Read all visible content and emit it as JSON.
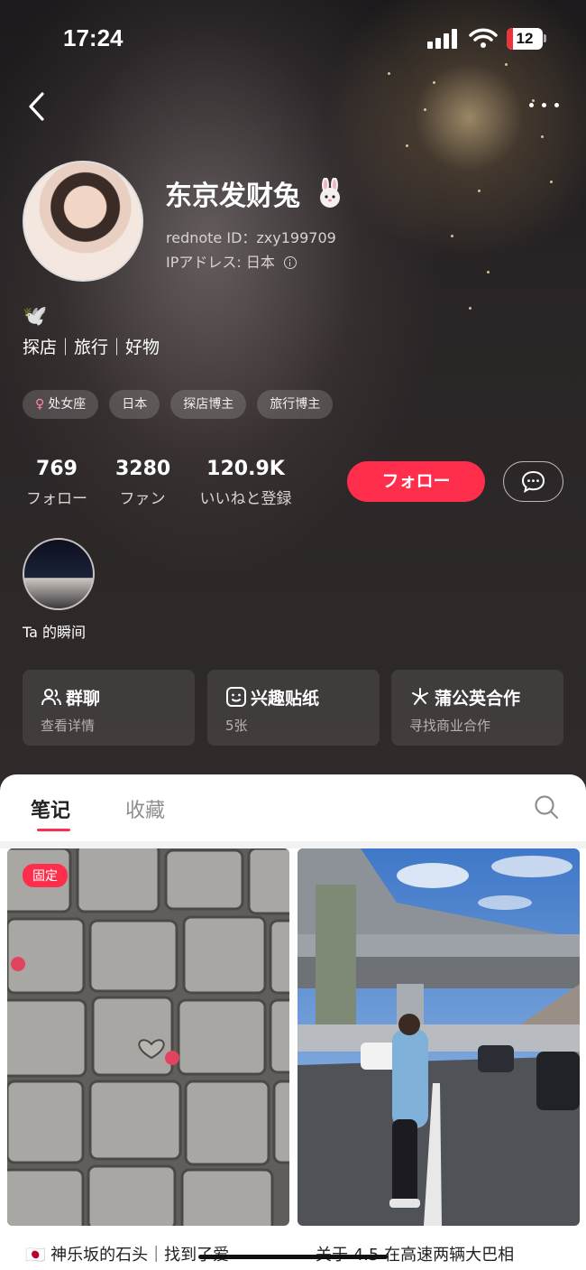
{
  "status_bar": {
    "time": "17:24",
    "battery": "12"
  },
  "profile": {
    "name": "东京发财兔",
    "rednote_id": "rednote ID：zxy199709",
    "ip": "IPアドレス: 日本",
    "bio_emoji": "🕊️",
    "bio": "探店｜旅行｜好物",
    "tags": [
      "处女座",
      "日本",
      "探店博主",
      "旅行博主"
    ]
  },
  "stats": [
    {
      "value": "769",
      "label": "フォロー"
    },
    {
      "value": "3280",
      "label": "ファン"
    },
    {
      "value": "120.9K",
      "label": "いいねと登録"
    }
  ],
  "follow_button": "フォロー",
  "moment": {
    "label": "Ta 的瞬间"
  },
  "feature_cards": [
    {
      "title": "群聊",
      "subtitle": "查看详情",
      "icon": "group-icon"
    },
    {
      "title": "兴趣贴纸",
      "subtitle": "5张",
      "icon": "sticker-icon"
    },
    {
      "title": "蒲公英合作",
      "subtitle": "寻找商业合作",
      "icon": "dandelion-icon"
    }
  ],
  "tabs": {
    "notes": "笔记",
    "favorites": "收藏"
  },
  "notes": [
    {
      "badge": "固定",
      "title": "🇯🇵 神乐坂的石头｜找到了爱"
    },
    {
      "title": "关于 4.5 在高速两辆大巴相"
    }
  ],
  "colors": {
    "accent": "#ff2e4d",
    "header_bg": "#2d2828"
  }
}
